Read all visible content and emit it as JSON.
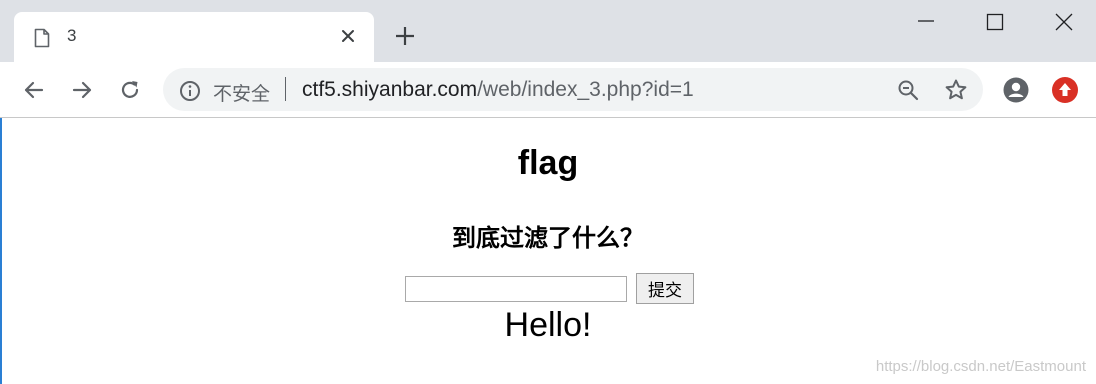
{
  "tab": {
    "title": "3",
    "close_icon": "close-icon",
    "page_icon": "page-icon"
  },
  "window_controls": {
    "minimize": "minimize-icon",
    "maximize": "maximize-icon",
    "close": "close-icon"
  },
  "toolbar": {
    "omnibox": {
      "security_label": "不安全",
      "url_host": "ctf5.shiyanbar.com",
      "url_path": "/web/index_3.php?id=1"
    }
  },
  "page": {
    "heading": "flag",
    "subheading": "到底过滤了什么？",
    "input_value": "",
    "submit_label": "提交",
    "output_text": "Hello!"
  },
  "watermark": "https://blog.csdn.net/Eastmount",
  "colors": {
    "tabstrip": "#dee1e6",
    "omnibox": "#f1f3f4",
    "extension": "#d93025",
    "icon": "#5f6368"
  }
}
